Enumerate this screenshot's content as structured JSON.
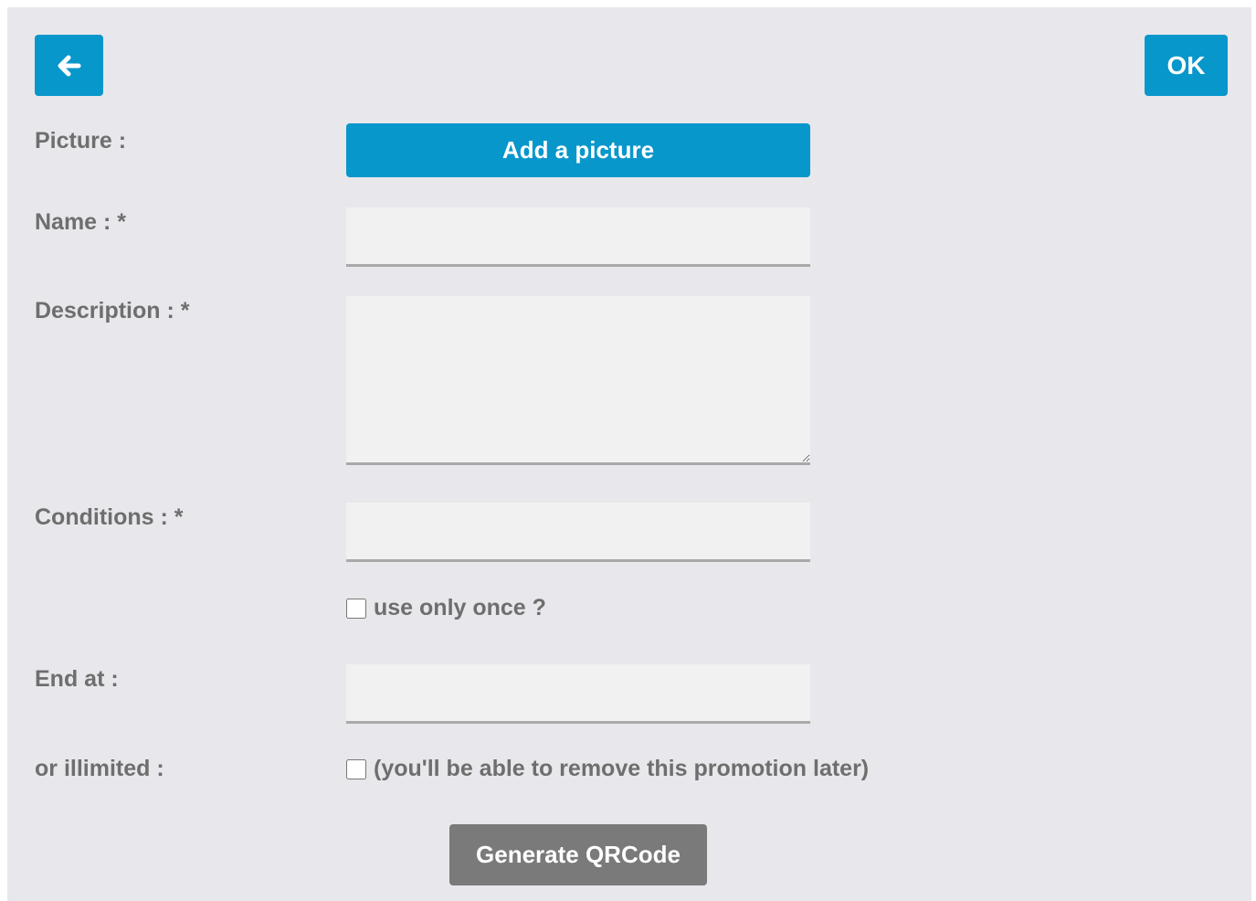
{
  "header": {
    "back_icon": "arrow-left-icon",
    "ok_label": "OK"
  },
  "form": {
    "picture_label": "Picture :",
    "add_picture_label": "Add a picture",
    "name_label": "Name : *",
    "name_value": "",
    "description_label": "Description : *",
    "description_value": "",
    "conditions_label": "Conditions : *",
    "conditions_value": "",
    "use_once_label": "use only once ?",
    "use_once_checked": false,
    "end_at_label": "End at :",
    "end_at_value": "",
    "unlimited_label": "or illimited :",
    "unlimited_text": "(you'll be able to remove this promotion later)",
    "unlimited_checked": false,
    "generate_label": "Generate QRCode"
  },
  "colors": {
    "accent": "#0897cb",
    "background": "#e8e7eb",
    "label": "#6e6e6e",
    "secondary_button": "#7a7a7a"
  }
}
